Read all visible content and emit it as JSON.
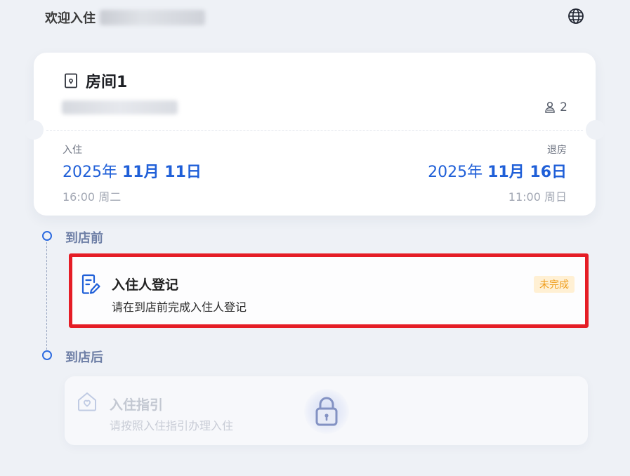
{
  "header": {
    "welcome_text": "欢迎入住"
  },
  "room_card": {
    "room_title": "房间1",
    "guest_count": "2",
    "checkin": {
      "label": "入住",
      "year": "2025年",
      "month_day": "11月 11日",
      "time": "16:00 周二"
    },
    "checkout": {
      "label": "退房",
      "year": "2025年",
      "month_day": "11月 16日",
      "time": "11:00 周日"
    }
  },
  "timeline": {
    "before_arrival_label": "到店前",
    "after_arrival_label": "到店后"
  },
  "tasks": {
    "guest_registration": {
      "title": "入住人登记",
      "description": "请在到店前完成入住人登记",
      "status": "未完成"
    },
    "checkin_guide": {
      "title": "入住指引",
      "description": "请按照入住指引办理入住"
    }
  },
  "icons": {
    "language": "globe-icon",
    "room": "door-icon",
    "guests": "people-icon",
    "registration": "form-edit-icon",
    "guide": "house-heart-icon",
    "locked": "lock-icon"
  },
  "colors": {
    "accent": "#1f5fd8",
    "highlight_border": "#e51d26",
    "pending_badge_bg": "#fff0d4",
    "pending_badge_text": "#ef9d1b",
    "timeline_label": "#6e7fa6"
  }
}
